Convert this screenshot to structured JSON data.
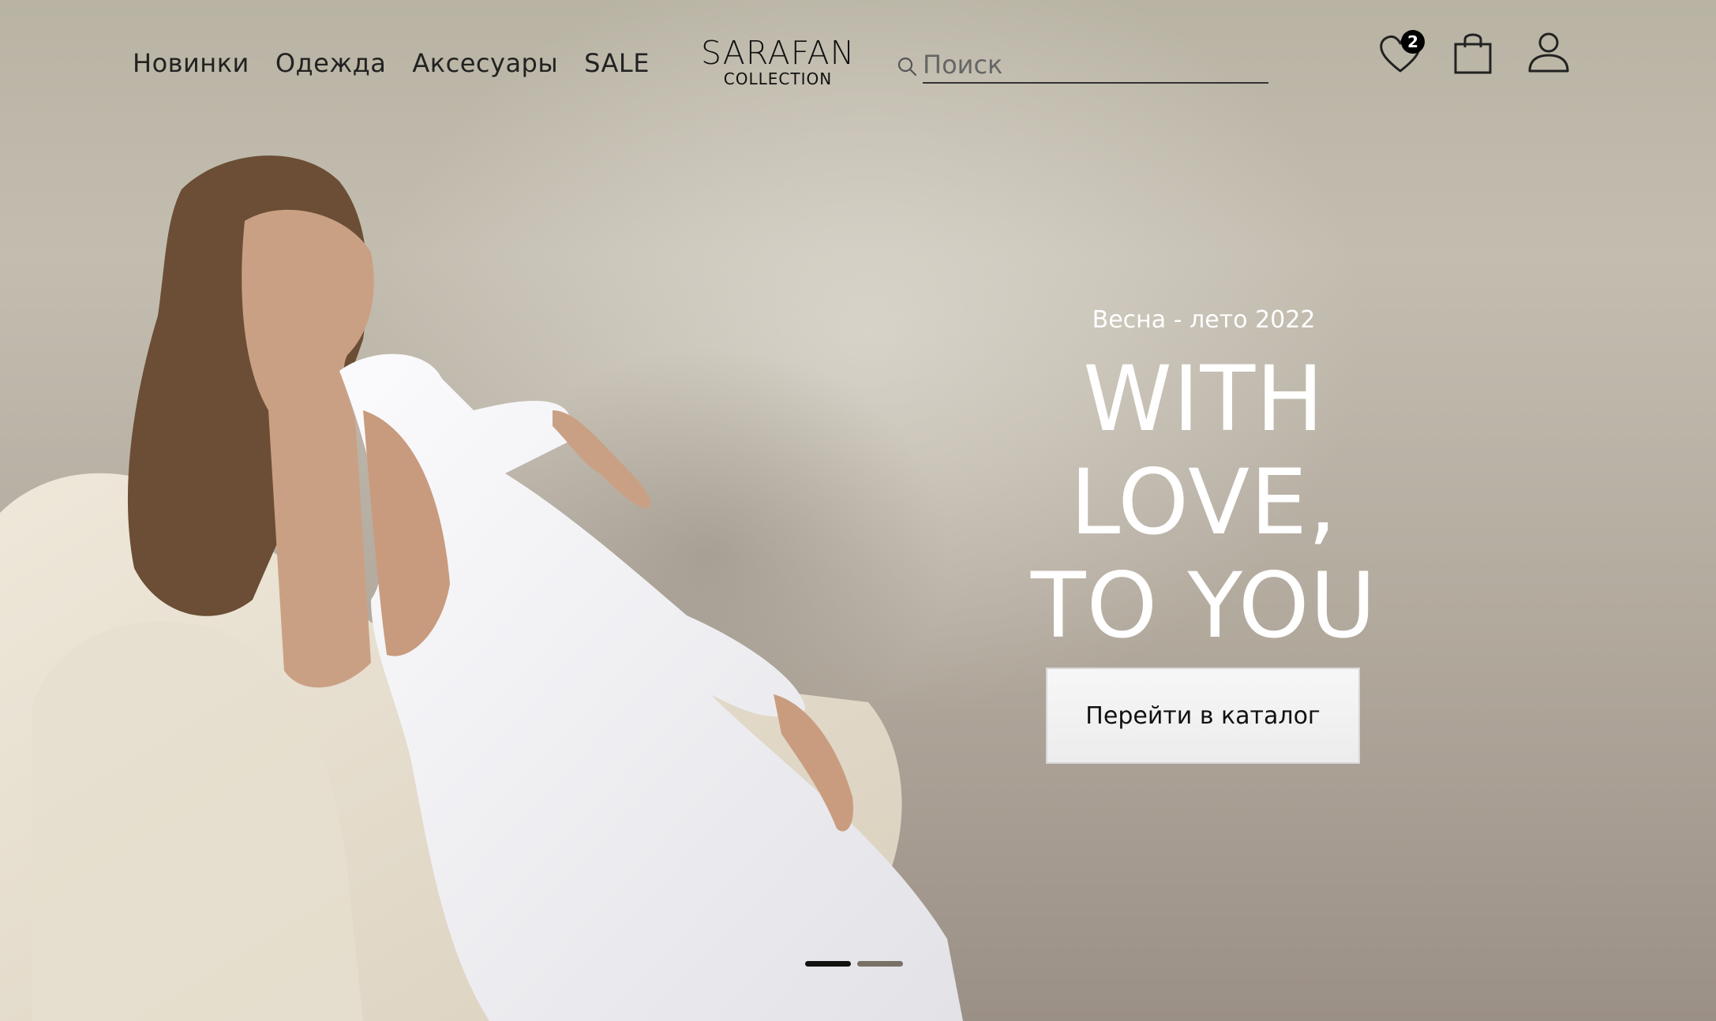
{
  "header": {
    "nav": [
      "Новинки",
      "Одежда",
      "Аксесуары",
      "SALE"
    ],
    "logo": {
      "main": "SARAFAN",
      "sub": "COLLECTION"
    },
    "search": {
      "placeholder": "Поиск",
      "value": ""
    },
    "wishlist_count": "2"
  },
  "hero": {
    "season": "Весна - лето 2022",
    "headline": [
      "WITH",
      "LOVE,",
      "TO YOU"
    ],
    "cta_label": "Перейти в каталог",
    "slides": {
      "count": 2,
      "active": 1
    }
  },
  "colors": {
    "text_dark": "#222222",
    "hero_text": "#ffffff",
    "button_bg": "#f2f2f2",
    "dress": "#f4f4f6",
    "armchair": "#e8e0d0"
  },
  "icons": [
    "search-icon",
    "heart-icon",
    "shopping-bag-icon",
    "user-icon"
  ]
}
